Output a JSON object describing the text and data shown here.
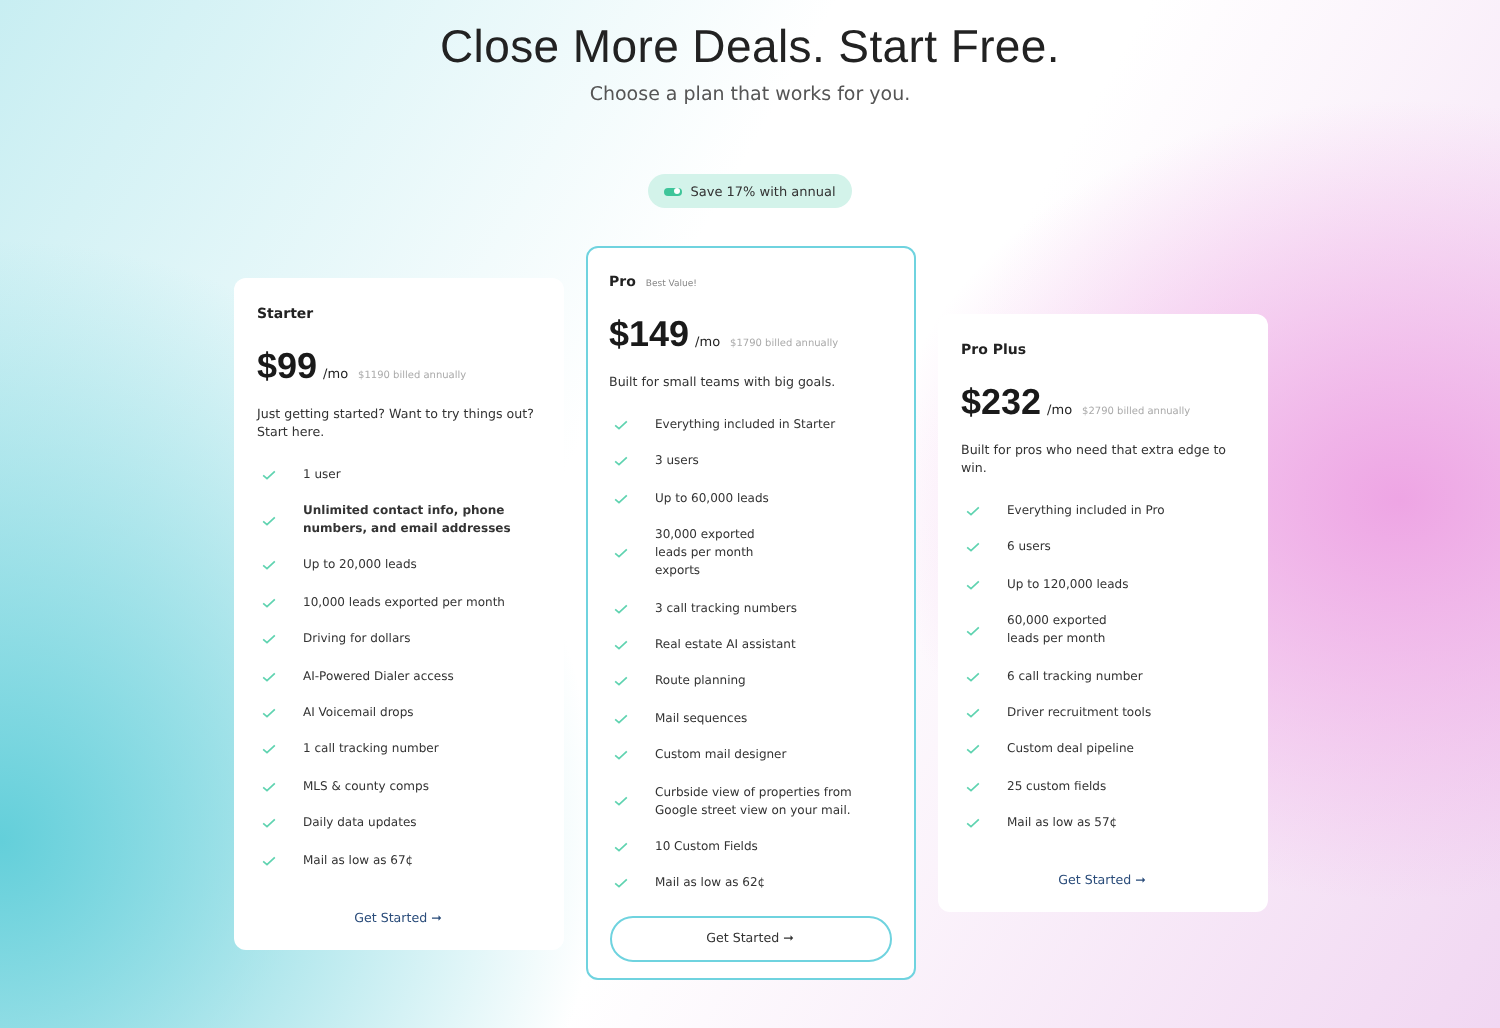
{
  "header": {
    "title": "Close More Deals. Start Free.",
    "subtitle": "Choose a plan that works for you."
  },
  "annual_toggle": {
    "label": "Save 17% with annual",
    "on": true
  },
  "plans": [
    {
      "name": "Starter",
      "featured": false,
      "price": "$99",
      "period": "/mo",
      "billed": "$1190 billed annually",
      "description": "Just getting started? Want to try things out? Start here.",
      "features": [
        {
          "text": "1 user"
        },
        {
          "text": "Unlimited contact info, phone numbers, and email addresses",
          "bold": true
        },
        {
          "text": "Up to 20,000 leads"
        },
        {
          "text": "10,000 leads exported per month"
        },
        {
          "text": "Driving for dollars"
        },
        {
          "text": "AI-Powered Dialer access"
        },
        {
          "text": "AI Voicemail drops"
        },
        {
          "text": "1 call tracking number"
        },
        {
          "text": "MLS & county comps"
        },
        {
          "text": "Daily data updates"
        },
        {
          "text": "Mail as low as 67¢"
        }
      ],
      "cta": "Get Started ➞"
    },
    {
      "name": "Pro",
      "badge": "Best Value!",
      "featured": true,
      "price": "$149",
      "period": "/mo",
      "billed": "$1790 billed annually",
      "description": "Built for small teams with big goals.",
      "features": [
        {
          "text": "Everything included in Starter"
        },
        {
          "text": "3 users"
        },
        {
          "text": "Up to 60,000 leads"
        },
        {
          "text": "30,000 exported\nleads per month\nexports"
        },
        {
          "text": "3 call tracking numbers"
        },
        {
          "text": "Real estate AI assistant"
        },
        {
          "text": "Route planning"
        },
        {
          "text": "Mail sequences"
        },
        {
          "text": "Custom mail designer"
        },
        {
          "text": "Curbside view of properties from Google street view on your mail."
        },
        {
          "text": "10 Custom Fields"
        },
        {
          "text": "Mail as low as 62¢"
        }
      ],
      "cta": "Get Started ➞"
    },
    {
      "name": "Pro Plus",
      "featured": false,
      "price": "$232",
      "period": "/mo",
      "billed": "$2790 billed annually",
      "description": "Built for pros who need that extra edge to win.",
      "features": [
        {
          "text": "Everything included in Pro"
        },
        {
          "text": "6 users"
        },
        {
          "text": "Up to 120,000 leads"
        },
        {
          "text": "60,000 exported\nleads per month"
        },
        {
          "text": "6 call tracking number"
        },
        {
          "text": "Driver recruitment tools"
        },
        {
          "text": "Custom deal pipeline"
        },
        {
          "text": "25 custom fields"
        },
        {
          "text": "Mail as low as 57¢"
        }
      ],
      "cta": "Get Started ➞"
    }
  ]
}
